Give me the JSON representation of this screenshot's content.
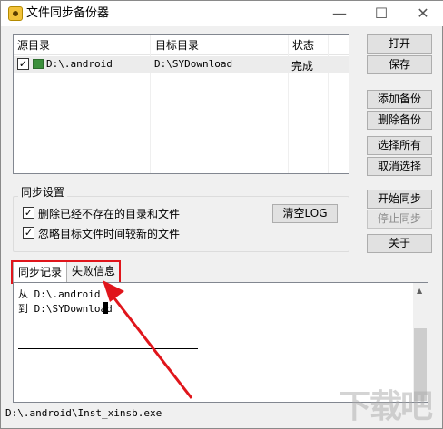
{
  "window": {
    "title": "文件同步备份器",
    "minimize_icon": "minimize-icon",
    "maximize_icon": "maximize-icon",
    "close_icon": "close-icon"
  },
  "list": {
    "columns": [
      "源目录",
      "目标目录",
      "状态"
    ],
    "rows": [
      {
        "source": "D:\\.android",
        "target": "D:\\SYDownload",
        "status": "完成",
        "checked": true
      }
    ]
  },
  "buttons": {
    "open": "打开",
    "save": "保存",
    "add_backup": "添加备份",
    "delete_backup": "删除备份",
    "select_all": "选择所有",
    "cancel_select": "取消选择",
    "start_sync": "开始同步",
    "stop_sync": "停止同步",
    "about": "关于"
  },
  "sync_settings": {
    "label": "同步设置",
    "delete_missing": "删除已经不存在的目录和文件",
    "ignore_newer": "忽略目标文件时间较新的文件",
    "clear_log": "清空LOG"
  },
  "tabs": [
    "同步记录",
    "失败信息"
  ],
  "log": {
    "line1": "从 D:\\.android",
    "line2": "到 D:\\SYDownload"
  },
  "status_bar": "D:\\.android\\Inst_xinsb.exe",
  "watermark": "下载吧",
  "colors": {
    "annotation": "#e0151b"
  }
}
